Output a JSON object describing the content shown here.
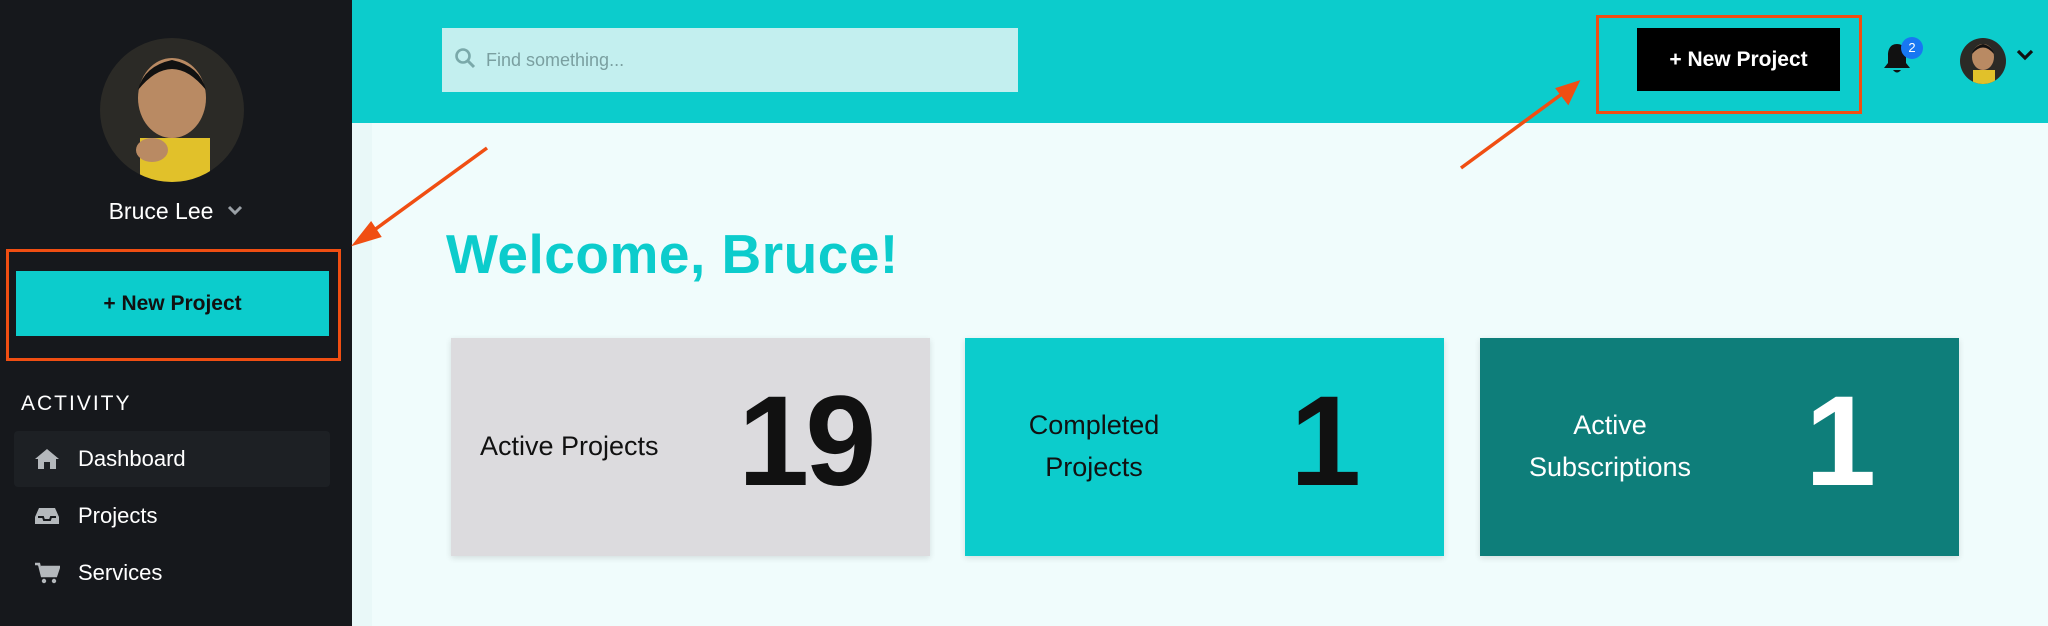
{
  "sidebar": {
    "user_name": "Bruce Lee",
    "new_project_label": "+ New Project",
    "section_heading": "ACTIVITY",
    "items": [
      {
        "label": "Dashboard",
        "icon": "home-icon"
      },
      {
        "label": "Projects",
        "icon": "inbox-icon"
      },
      {
        "label": "Services",
        "icon": "cart-icon"
      }
    ]
  },
  "topbar": {
    "search_placeholder": "Find something...",
    "new_project_label": "+ New Project",
    "notification_count": "2"
  },
  "main": {
    "welcome": "Welcome, Bruce!",
    "stats": [
      {
        "label": "Active Projects",
        "value": "19"
      },
      {
        "label_line1": "Completed",
        "label_line2": "Projects",
        "value": "1"
      },
      {
        "label_line1": "Active",
        "label_line2": "Subscriptions",
        "value": "1"
      }
    ]
  },
  "colors": {
    "brand": "#0ccccc",
    "sidebar_bg": "#16181c",
    "card_grey": "#dcdbde",
    "card_dark_teal": "#0e7e7a",
    "annotation": "#f04e12",
    "badge": "#1877f2"
  }
}
